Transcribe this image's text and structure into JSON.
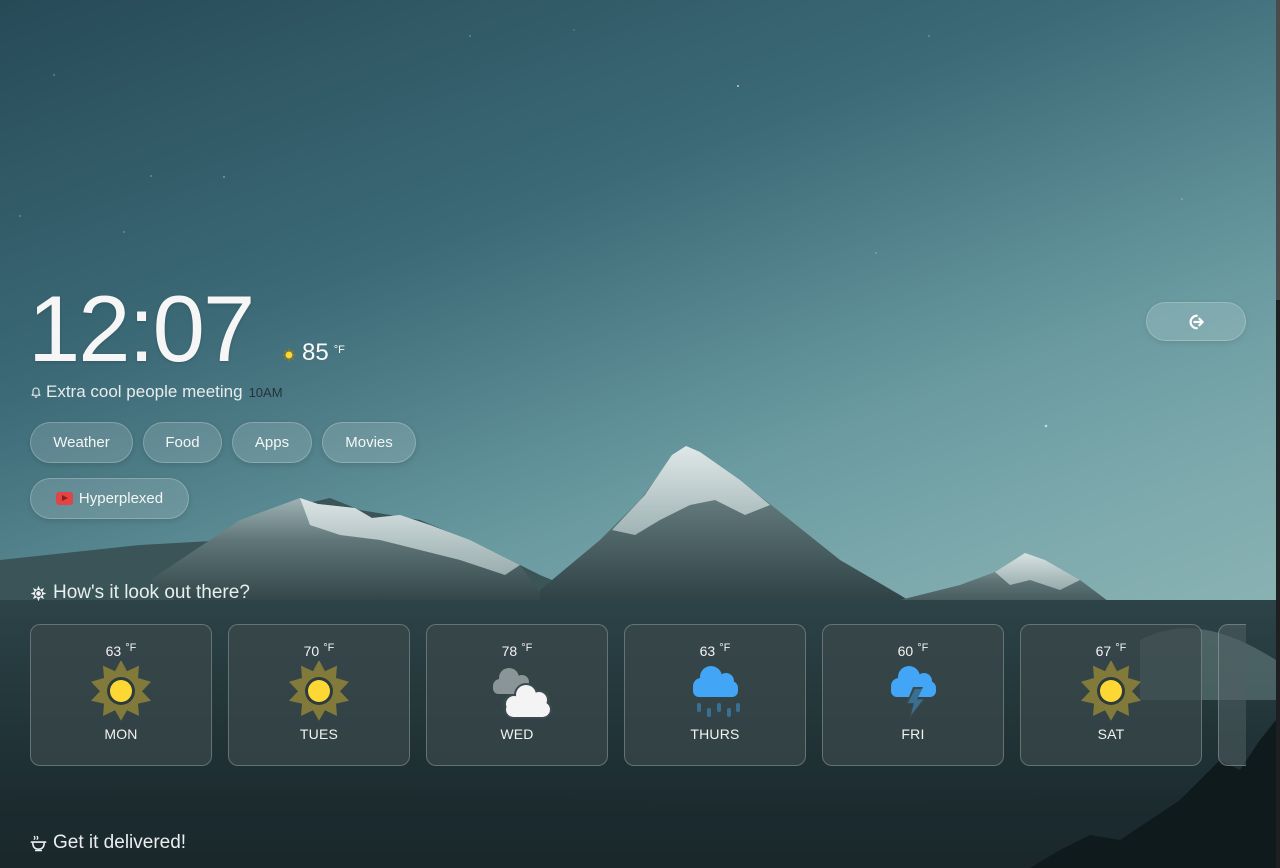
{
  "clock": {
    "time": "12:07"
  },
  "current_weather": {
    "icon": "sun-icon",
    "temperature": "85",
    "unit": "°F"
  },
  "reminder": {
    "icon": "bell-icon",
    "title": "Extra cool people meeting",
    "time": "10AM"
  },
  "quick_links": [
    {
      "label": "Weather"
    },
    {
      "label": "Food"
    },
    {
      "label": "Apps"
    },
    {
      "label": "Movies"
    },
    {
      "label": "Hyperplexed",
      "icon": "youtube-icon"
    }
  ],
  "logout": {
    "icon": "logout-icon"
  },
  "weather_section": {
    "title": "How's it look out there?",
    "icon": "gear-sun-icon",
    "forecast": [
      {
        "day": "MON",
        "temperature": "63",
        "unit": "°F",
        "condition": "sunny",
        "icon": "sun-icon"
      },
      {
        "day": "TUES",
        "temperature": "70",
        "unit": "°F",
        "condition": "sunny",
        "icon": "sun-icon"
      },
      {
        "day": "WED",
        "temperature": "78",
        "unit": "°F",
        "condition": "cloudy",
        "icon": "clouds-icon"
      },
      {
        "day": "THURS",
        "temperature": "63",
        "unit": "°F",
        "condition": "rain",
        "icon": "rain-cloud-icon"
      },
      {
        "day": "FRI",
        "temperature": "60",
        "unit": "°F",
        "condition": "storm",
        "icon": "thunder-cloud-icon"
      },
      {
        "day": "SAT",
        "temperature": "67",
        "unit": "°F",
        "condition": "sunny",
        "icon": "sun-icon"
      }
    ]
  },
  "delivery_section": {
    "title": "Get it delivered!",
    "icon": "bowl-icon"
  },
  "colors": {
    "sun_rays": "#827a3a",
    "sun_core": "#fdd835",
    "rain_cloud": "#42a5f5",
    "rain_drops": "#3a6f94",
    "cloud_white": "#f4f4f4",
    "cloud_grey": "#8a9597",
    "youtube_red": "#e04545"
  }
}
